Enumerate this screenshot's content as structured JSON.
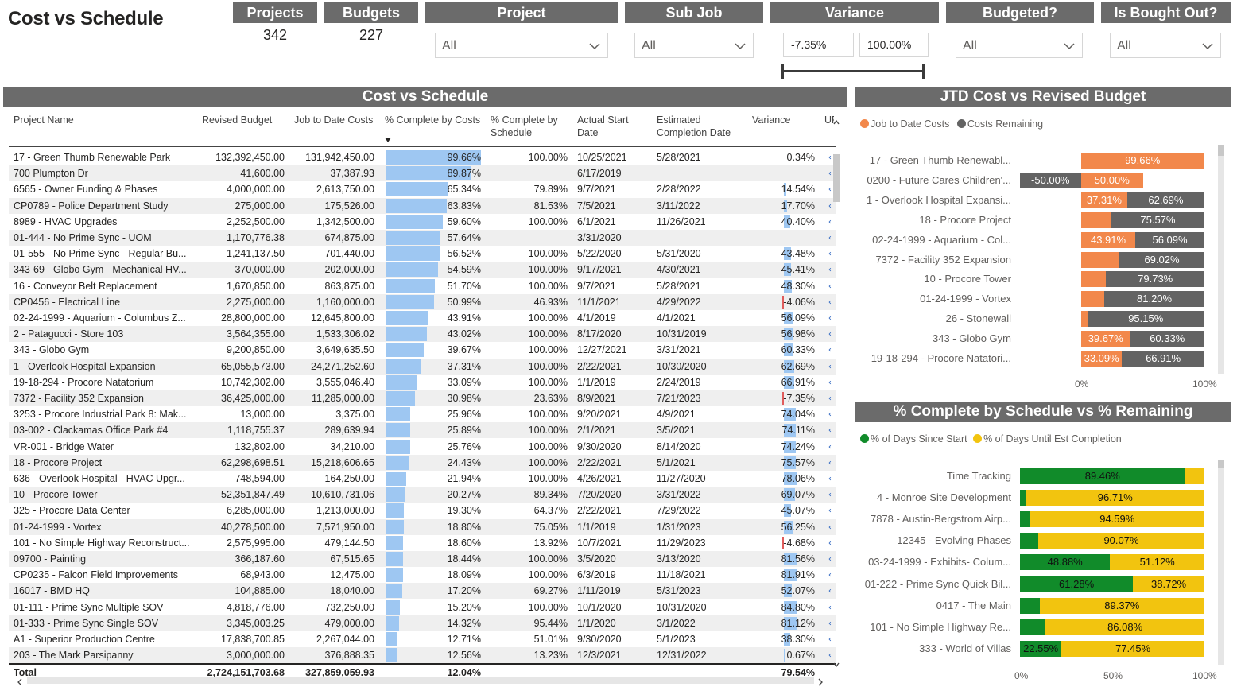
{
  "title": "Cost vs Schedule",
  "cards": [
    {
      "label": "Projects",
      "value": "342"
    },
    {
      "label": "Budgets",
      "value": "227"
    }
  ],
  "slicers": {
    "project": {
      "label": "Project",
      "value": "All"
    },
    "sub_job": {
      "label": "Sub Job",
      "value": "All"
    },
    "variance": {
      "label": "Variance",
      "min": "-7.35%",
      "max": "100.00%"
    },
    "budgeted": {
      "label": "Budgeted?",
      "value": "All"
    },
    "bought_out": {
      "label": "Is Bought Out?",
      "value": "All"
    }
  },
  "table": {
    "title": "Cost vs Schedule",
    "columns": [
      "Project Name",
      "Revised Budget",
      "Job to Date Costs",
      "% Complete by Costs",
      "% Complete by Schedule",
      "Actual Start Date",
      "Estimated Completion Date",
      "Variance",
      "UF"
    ],
    "rows": [
      [
        "17 - Green Thumb Renewable Park",
        "132,392,450.00",
        "131,942,450.00",
        "99.66%",
        "100.00%",
        "10/25/2021",
        "5/28/2021",
        "0.34%"
      ],
      [
        "700 Plumpton Dr",
        "41,600.00",
        "37,387.93",
        "89.87%",
        "",
        "6/17/2019",
        "",
        ""
      ],
      [
        "6565 - Owner Funding & Phases",
        "4,000,000.00",
        "2,613,750.00",
        "65.34%",
        "79.89%",
        "9/7/2021",
        "2/28/2022",
        "14.54%"
      ],
      [
        "CP0789 - Police Department Study",
        "275,000.00",
        "175,526.00",
        "63.83%",
        "81.53%",
        "7/5/2021",
        "3/11/2022",
        "17.70%"
      ],
      [
        "8989 - HVAC Upgrades",
        "2,252,500.00",
        "1,342,500.00",
        "59.60%",
        "100.00%",
        "6/1/2021",
        "11/26/2021",
        "40.40%"
      ],
      [
        "01-444 - No Prime Sync - UOM",
        "1,170,776.38",
        "674,875.00",
        "57.64%",
        "",
        "3/31/2020",
        "",
        ""
      ],
      [
        "01-555 - No Prime Sync - Regular Bu...",
        "1,241,137.50",
        "701,440.00",
        "56.52%",
        "100.00%",
        "5/22/2020",
        "5/31/2020",
        "43.48%"
      ],
      [
        "343-69 - Globo Gym - Mechanical HV...",
        "370,000.00",
        "202,000.00",
        "54.59%",
        "100.00%",
        "9/17/2021",
        "4/30/2021",
        "45.41%"
      ],
      [
        "16 - Conveyor Belt Replacement",
        "1,670,850.00",
        "863,875.00",
        "51.70%",
        "100.00%",
        "9/7/2021",
        "5/28/2021",
        "48.30%"
      ],
      [
        "CP0456 - Electrical Line",
        "2,275,000.00",
        "1,160,000.00",
        "50.99%",
        "46.93%",
        "11/1/2021",
        "4/29/2022",
        "-4.06%"
      ],
      [
        "02-24-1999 - Aquarium - Columbus Z...",
        "28,800,000.00",
        "12,645,800.00",
        "43.91%",
        "100.00%",
        "4/1/2019",
        "4/1/2021",
        "56.09%"
      ],
      [
        "2 - Patagucci - Store 103",
        "3,564,355.00",
        "1,533,306.02",
        "43.02%",
        "100.00%",
        "8/17/2020",
        "10/31/2019",
        "56.98%"
      ],
      [
        "343 - Globo Gym",
        "9,200,850.00",
        "3,649,635.50",
        "39.67%",
        "100.00%",
        "12/27/2021",
        "3/31/2021",
        "60.33%"
      ],
      [
        "1 - Overlook Hospital Expansion",
        "65,055,573.00",
        "24,271,252.60",
        "37.31%",
        "100.00%",
        "2/22/2021",
        "10/30/2020",
        "62.69%"
      ],
      [
        "19-18-294 - Procore Natatorium",
        "10,742,302.00",
        "3,555,046.40",
        "33.09%",
        "100.00%",
        "1/1/2019",
        "2/24/2019",
        "66.91%"
      ],
      [
        "7372 - Facility 352 Expansion",
        "36,425,000.00",
        "11,285,000.00",
        "30.98%",
        "23.63%",
        "8/9/2021",
        "7/21/2023",
        "-7.35%"
      ],
      [
        "3253 - Procore Industrial Park 8: Mak...",
        "13,000.00",
        "3,375.00",
        "25.96%",
        "100.00%",
        "9/20/2021",
        "4/9/2021",
        "74.04%"
      ],
      [
        "03-002 - Clackamas Office Park #4",
        "1,118,755.37",
        "289,639.94",
        "25.89%",
        "100.00%",
        "2/1/2021",
        "3/5/2021",
        "74.11%"
      ],
      [
        "VR-001 - Bridge Water",
        "132,802.00",
        "34,210.00",
        "25.76%",
        "100.00%",
        "9/30/2020",
        "8/14/2020",
        "74.24%"
      ],
      [
        "18 - Procore Project",
        "62,298,698.51",
        "15,218,606.65",
        "24.43%",
        "100.00%",
        "2/22/2021",
        "5/1/2021",
        "75.57%"
      ],
      [
        "636 - Overlook Hospital - HVAC Upgr...",
        "748,594.00",
        "164,250.00",
        "21.94%",
        "100.00%",
        "4/26/2021",
        "11/27/2020",
        "78.06%"
      ],
      [
        "10 - Procore Tower",
        "52,351,847.49",
        "10,610,731.06",
        "20.27%",
        "89.34%",
        "7/20/2020",
        "3/31/2022",
        "69.07%"
      ],
      [
        "325 - Procore Data Center",
        "6,285,000.00",
        "1,213,000.00",
        "19.30%",
        "64.37%",
        "2/22/2021",
        "7/29/2022",
        "45.07%"
      ],
      [
        "01-24-1999 - Vortex",
        "40,278,500.00",
        "7,571,950.00",
        "18.80%",
        "75.05%",
        "1/1/2019",
        "1/31/2023",
        "56.25%"
      ],
      [
        "101 - No Simple Highway Reconstruct...",
        "2,575,995.00",
        "479,144.50",
        "18.60%",
        "13.92%",
        "10/7/2021",
        "11/29/2023",
        "-4.68%"
      ],
      [
        "09700 - Painting",
        "366,187.60",
        "67,515.65",
        "18.44%",
        "100.00%",
        "3/5/2020",
        "3/13/2020",
        "81.56%"
      ],
      [
        "CP0235 - Falcon Field Improvements",
        "68,943.00",
        "12,475.00",
        "18.09%",
        "100.00%",
        "6/3/2019",
        "11/18/2021",
        "81.91%"
      ],
      [
        "16017 - BMD HQ",
        "104,885.00",
        "18,040.00",
        "17.20%",
        "69.27%",
        "1/11/2019",
        "5/31/2023",
        "52.07%"
      ],
      [
        "01-111 - Prime Sync Multiple SOV",
        "4,818,776.00",
        "732,250.00",
        "15.20%",
        "100.00%",
        "10/1/2020",
        "10/31/2020",
        "84.80%"
      ],
      [
        "01-333 - Prime Sync Single SOV",
        "3,345,003.25",
        "479,000.00",
        "14.32%",
        "95.44%",
        "1/1/2020",
        "3/1/2022",
        "81.12%"
      ],
      [
        "A1 - Superior Production Centre",
        "17,838,700.85",
        "2,267,044.00",
        "12.71%",
        "51.01%",
        "9/30/2020",
        "5/1/2023",
        "38.30%"
      ],
      [
        "203 - The Mark Parsipanny",
        "3,000,000.00",
        "376,888.35",
        "12.56%",
        "13.23%",
        "12/3/2021",
        "12/31/2022",
        "0.67%"
      ]
    ],
    "total": {
      "label": "Total",
      "revised_budget": "2,724,151,703.68",
      "jtd_costs": "327,859,059.93",
      "pct_costs": "12.04%",
      "variance": "79.54%"
    }
  },
  "chart_data": [
    {
      "type": "bar",
      "title": "JTD Cost vs Revised Budget",
      "orientation": "horizontal-stacked",
      "legend_position": "top-left",
      "categories": [
        "17 - Green Thumb Renewabl...",
        "0200 - Future Cares Children'...",
        "1 - Overlook Hospital Expansi...",
        "18 - Procore Project",
        "02-24-1999 - Aquarium - Col...",
        "7372 - Facility 352 Expansion",
        "10 - Procore Tower",
        "01-24-1999 - Vortex",
        "26 - Stonewall",
        "343 - Globo Gym",
        "19-18-294 - Procore Natatori..."
      ],
      "series": [
        {
          "name": "Job to Date Costs",
          "color": "#f2884b",
          "values": [
            99.66,
            50.0,
            37.31,
            24.43,
            43.91,
            30.98,
            20.27,
            18.8,
            4.85,
            39.67,
            33.09
          ],
          "labels": [
            "99.66%",
            "50.00%",
            "37.31%",
            "",
            "43.91%",
            "",
            "",
            "",
            "",
            "39.67%",
            "33.09%"
          ]
        },
        {
          "name": "Costs Remaining",
          "color": "#636363",
          "values": [
            0.34,
            -50.0,
            62.69,
            75.57,
            56.09,
            69.02,
            79.73,
            81.2,
            95.15,
            60.33,
            66.91
          ],
          "labels": [
            "",
            "-50.00%",
            "62.69%",
            "75.57%",
            "56.09%",
            "69.02%",
            "79.73%",
            "81.20%",
            "95.15%",
            "60.33%",
            "66.91%"
          ]
        }
      ],
      "xlim": [
        0,
        100
      ],
      "xticks": [
        "0%",
        "100%"
      ]
    },
    {
      "type": "bar",
      "title": "% Complete by Schedule vs % Remaining",
      "orientation": "horizontal-stacked",
      "legend_position": "top-left",
      "categories": [
        "Time Tracking",
        "4 - Monroe Site Development",
        "7878 - Austin-Bergstrom Airp...",
        "12345 - Evolving Phases",
        "03-24-1999 - Exhibits- Colum...",
        "01-222 - Prime Sync Quick Bil...",
        "0417 - The Main",
        "101 - No Simple Highway Re...",
        "333 - World of Villas"
      ],
      "series": [
        {
          "name": "% of Days Since Start",
          "color": "#118b2a",
          "values": [
            89.46,
            3.29,
            5.41,
            9.93,
            48.88,
            61.28,
            10.63,
            13.92,
            22.55
          ],
          "labels": [
            "89.46%",
            "",
            "",
            "",
            "48.88%",
            "61.28%",
            "",
            "",
            "22.55%"
          ]
        },
        {
          "name": "% of Days Until Est Completion",
          "color": "#f2c40f",
          "values": [
            10.54,
            96.71,
            94.59,
            90.07,
            51.12,
            38.72,
            89.37,
            86.08,
            77.45
          ],
          "labels": [
            "",
            "96.71%",
            "94.59%",
            "90.07%",
            "51.12%",
            "38.72%",
            "89.37%",
            "86.08%",
            "77.45%"
          ]
        }
      ],
      "xlim": [
        0,
        100
      ],
      "xticks": [
        "0%",
        "50%",
        "100%"
      ]
    }
  ]
}
